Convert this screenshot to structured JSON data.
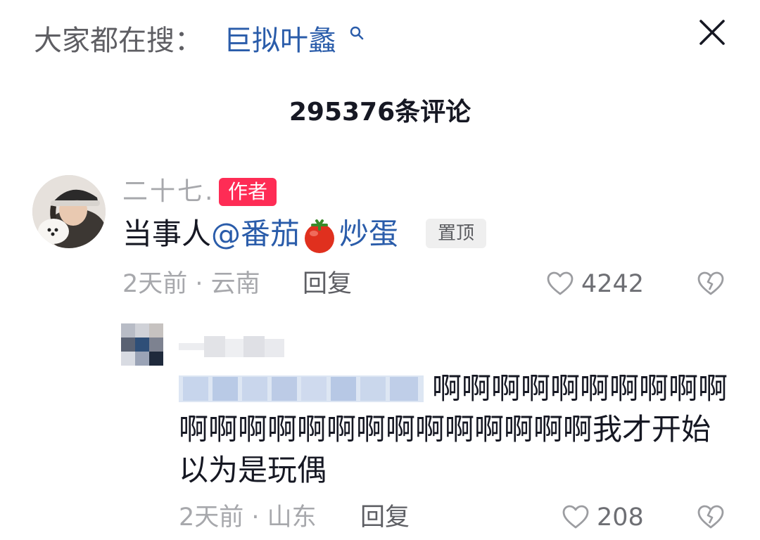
{
  "search_bar": {
    "prefix": "大家都在搜：",
    "term": "巨拟叶蠡",
    "icon": "search-icon"
  },
  "header": {
    "comment_count": "295376条评论",
    "close_icon": "close-icon"
  },
  "comments": [
    {
      "username": "二十七.",
      "author_badge": "作者",
      "text_prefix": "当事人",
      "mention_part1": "@番茄",
      "mention_emoji": "tomato-emoji",
      "mention_part2": "炒蛋",
      "pinned_badge": "置顶",
      "meta": "2天前 · 云南",
      "reply_label": "回复",
      "like_count": "4242"
    },
    {
      "text": "啊啊啊啊啊啊啊啊啊啊啊啊啊啊啊啊啊啊啊啊啊啊啊啊我才开始以为是玩偶",
      "meta": "2天前 · 山东",
      "reply_label": "回复",
      "like_count": "208"
    }
  ],
  "colors": {
    "accent_link": "#2a5caa",
    "author_badge_bg": "#fe2c55",
    "muted_text": "#a7a8ac",
    "primary_text": "#161823"
  }
}
